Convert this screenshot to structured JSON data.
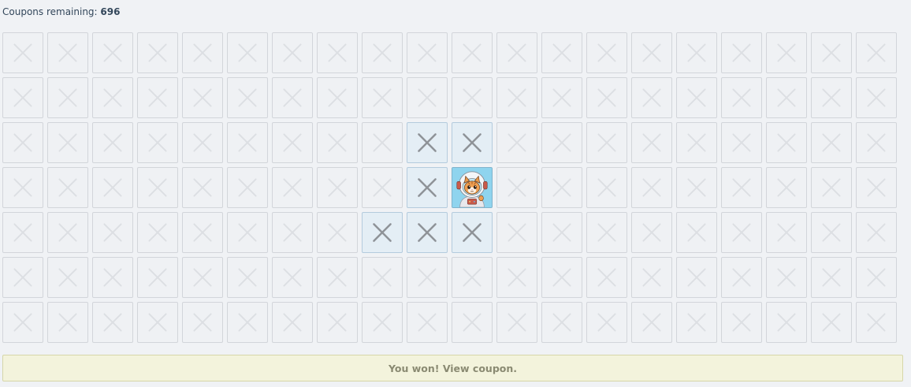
{
  "header": {
    "label": "Coupons remaining:",
    "count": "696"
  },
  "grid": {
    "rows": 7,
    "cols": 20,
    "revealed_cells": [
      [
        2,
        9
      ],
      [
        2,
        10
      ],
      [
        3,
        9
      ],
      [
        4,
        8
      ],
      [
        4,
        9
      ],
      [
        4,
        10
      ]
    ],
    "prize_cell": [
      3,
      10
    ],
    "cell_icon": "x-icon",
    "prize_icon": "astronaut-cat-icon"
  },
  "colors": {
    "page_bg": "#f0f2f5",
    "cell_bg": "#eff1f4",
    "revealed_bg": "#e4eef5",
    "prize_bg": "#8fd4ee",
    "banner_bg": "#f3f3dc",
    "banner_text": "#8a8a72"
  },
  "banner": {
    "text": "You won! View coupon."
  }
}
